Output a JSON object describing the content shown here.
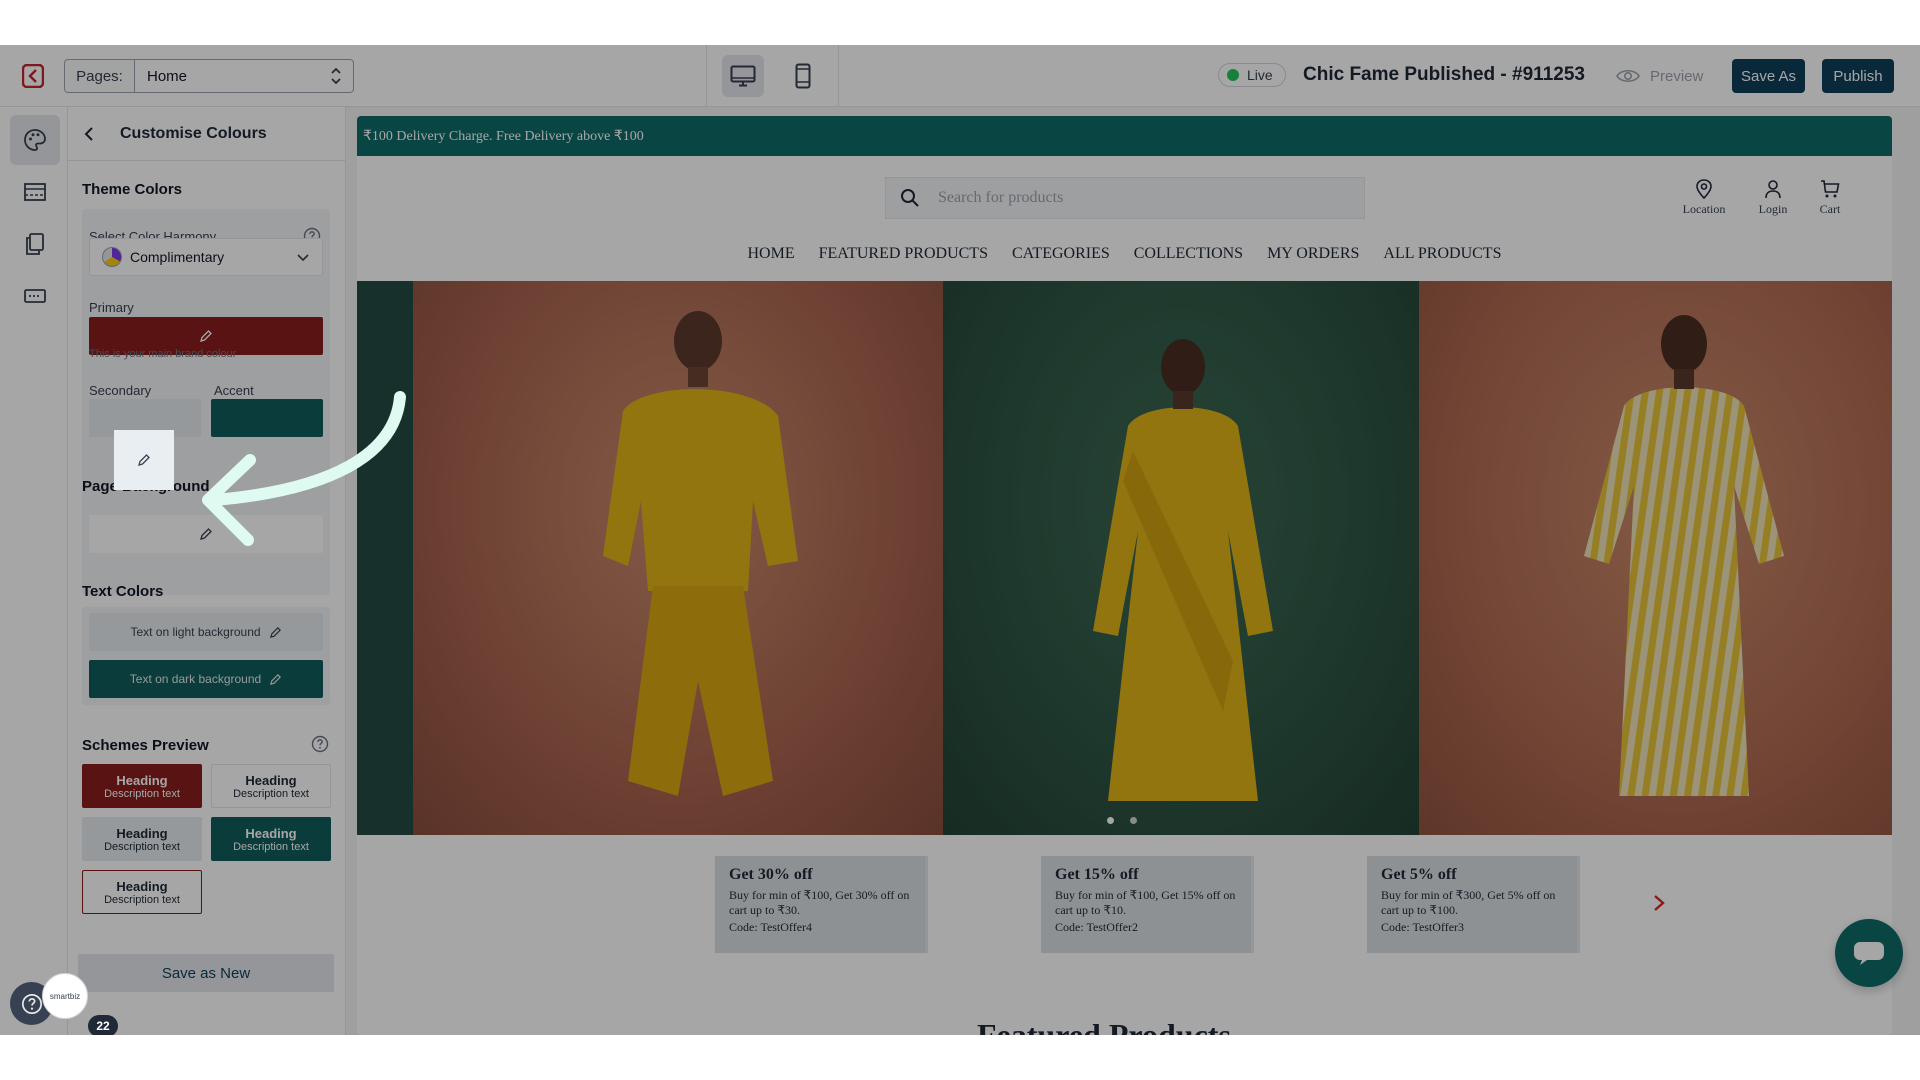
{
  "topbar": {
    "pages_label": "Pages:",
    "pages_value": "Home",
    "live_label": "Live",
    "site_title": "Chic Fame Published - #911253",
    "preview_label": "Preview",
    "save_as_label": "Save As",
    "publish_label": "Publish"
  },
  "panel": {
    "title": "Customise Colours",
    "theme_colors_title": "Theme Colors",
    "harmony_label": "Select Color Harmony",
    "harmony_value": "Complimentary",
    "primary_label": "Primary",
    "primary_hint": "This is your main brand colour",
    "secondary_label": "Secondary",
    "accent_label": "Accent",
    "page_background_title": "Page Background",
    "text_colors_title": "Text Colors",
    "text_light_label": "Text on light background",
    "text_dark_label": "Text on dark background",
    "schemes_title": "Schemes Preview",
    "schemes": [
      {
        "heading": "Heading",
        "desc": "Description text"
      },
      {
        "heading": "Heading",
        "desc": "Description text"
      },
      {
        "heading": "Heading",
        "desc": "Description text"
      },
      {
        "heading": "Heading",
        "desc": "Description text"
      },
      {
        "heading": "Heading",
        "desc": "Description text"
      }
    ],
    "save_new_label": "Save as New"
  },
  "floating": {
    "badge_count": "22",
    "smart_label": "smartbiz"
  },
  "store": {
    "announcement": "₹100 Delivery Charge. Free Delivery above ₹100",
    "search_placeholder": "Search for products",
    "header_icons": {
      "location": "Location",
      "login": "Login",
      "cart": "Cart"
    },
    "nav": [
      "HOME",
      "FEATURED PRODUCTS",
      "CATEGORIES",
      "COLLECTIONS",
      "MY ORDERS",
      "ALL PRODUCTS"
    ],
    "offers": [
      {
        "title": "Get 30% off",
        "desc": "Buy for min of ₹100, Get 30% off on cart up to ₹30.",
        "code": "Code: TestOffer4"
      },
      {
        "title": "Get 15% off",
        "desc": "Buy for min of ₹100, Get 15% off on cart up to ₹10.",
        "code": "Code: TestOffer2"
      },
      {
        "title": "Get 5% off",
        "desc": "Buy for min of ₹300, Get 5% off on cart up to ₹100.",
        "code": "Code: TestOffer3"
      }
    ],
    "featured_title": "Featured Products"
  },
  "colors": {
    "primary": "#8b1e1e",
    "secondary": "#e5ebee",
    "accent": "#0f5c5a",
    "brand_dark": "#0f3f5a",
    "announcement": "#0f6b68"
  }
}
